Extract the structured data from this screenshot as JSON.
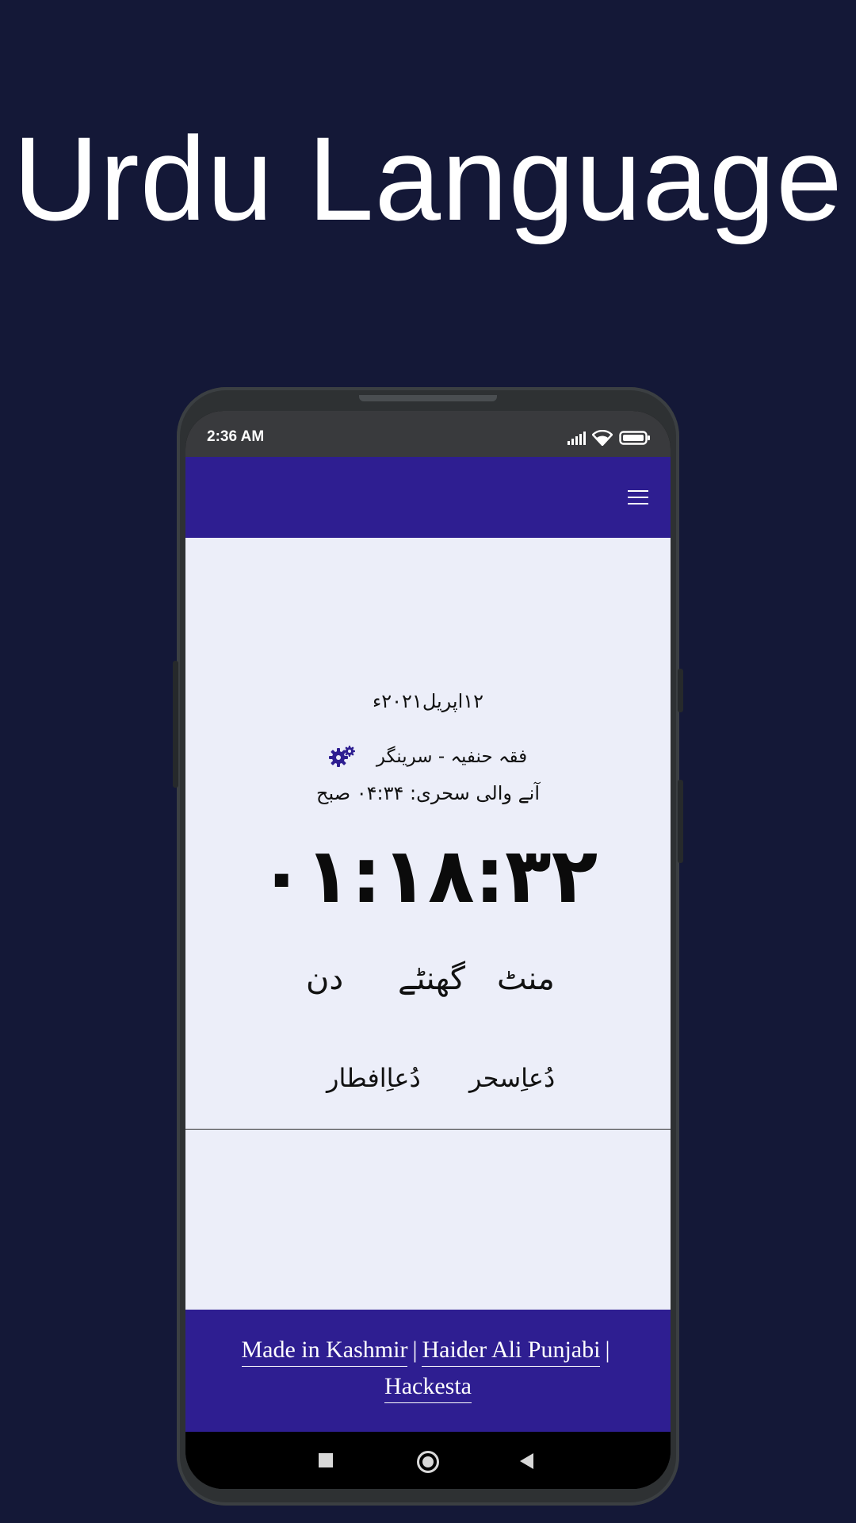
{
  "heading": "Urdu Language",
  "status_bar": {
    "time": "2:36 AM",
    "icons": [
      "signal-icon",
      "wifi-icon",
      "battery-icon"
    ]
  },
  "app_bar": {
    "menu_icon": "hamburger-menu-icon",
    "color": "#2e1e91"
  },
  "main": {
    "date": "۱۲اپریل۲۰۲۱ء",
    "location": "فقہ حنفیہ - سرینگر",
    "settings_icon": "gears-icon",
    "next_sehri": "آنے والی سحری: ۰۴:۳۴ صبح",
    "countdown": "۰۱:۱۸:۳۲",
    "units": {
      "minutes": "منٹ",
      "hours": "گھنٹے",
      "days": "دن"
    },
    "dua_sehri": "دُعاِسحر",
    "dua_iftar": "دُعاِافطار"
  },
  "footer": {
    "made_in": "Made in Kashmir",
    "author": "Haider Ali Punjabi",
    "brand": "Hackesta",
    "separator": "|"
  },
  "colors": {
    "background": "#141837",
    "accent": "#2e1e91",
    "content_bg": "#eceef9"
  },
  "nav_bar": [
    "recents-icon",
    "home-icon",
    "back-icon"
  ]
}
